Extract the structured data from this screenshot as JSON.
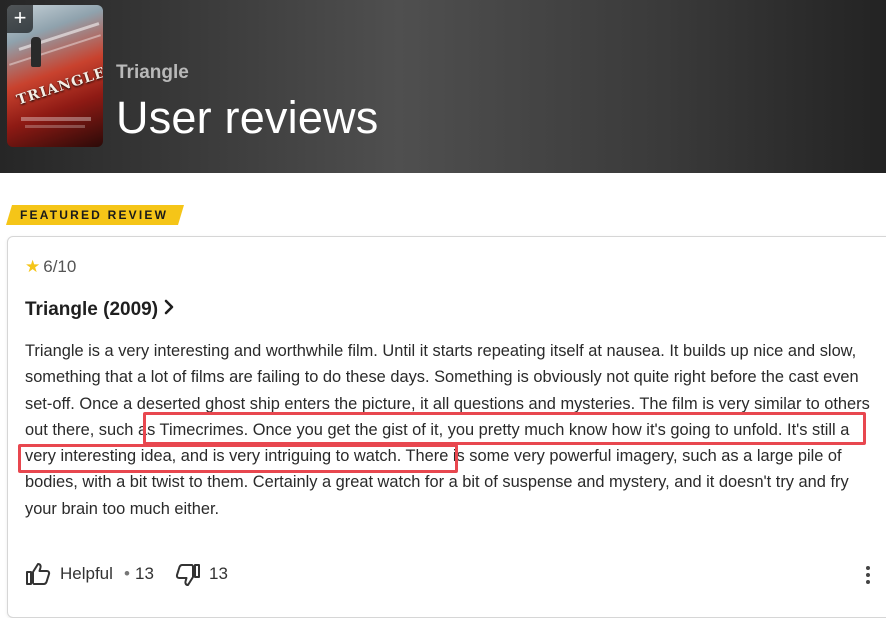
{
  "header": {
    "movie_title": "Triangle",
    "page_title": "User reviews",
    "poster_text": "TRIANGLE",
    "add_label": "+"
  },
  "featured_badge": "FEATURED REVIEW",
  "review": {
    "rating": "6/10",
    "title": "Triangle (2009)",
    "text_before": "Triangle is a very interesting and worthwhile film. Until it starts repeating itself at nausea. It builds up nice and slow, something that a lot of films are failing to do these days. Something is obviously not quite right before the cast even set-off. Once a deserted ghost ship enters the picture, it all questions and mysteries.",
    "text_highlight": " The film is very similar to others out there, such as Timecrimes. Once you get the gist of it, you pretty much know how it's going to unfold.",
    "text_after": " It's still a very interesting idea, and is very intriguing to watch. There is some very powerful imagery, such as a large pile of bodies, with a bit twist to them. Certainly a great watch for a bit of suspense and mystery, and it doesn't try and fry your brain too much either."
  },
  "actions": {
    "helpful_label": "Helpful",
    "separator": "•",
    "helpful_count": "13",
    "not_helpful_count": "13"
  },
  "colors": {
    "accent_yellow": "#f5c518",
    "highlight_box": "#e8474f"
  },
  "icons": [
    "add-icon",
    "star-icon",
    "chevron-right-icon",
    "thumbs-up-icon",
    "thumbs-down-icon",
    "more-vertical-icon"
  ]
}
